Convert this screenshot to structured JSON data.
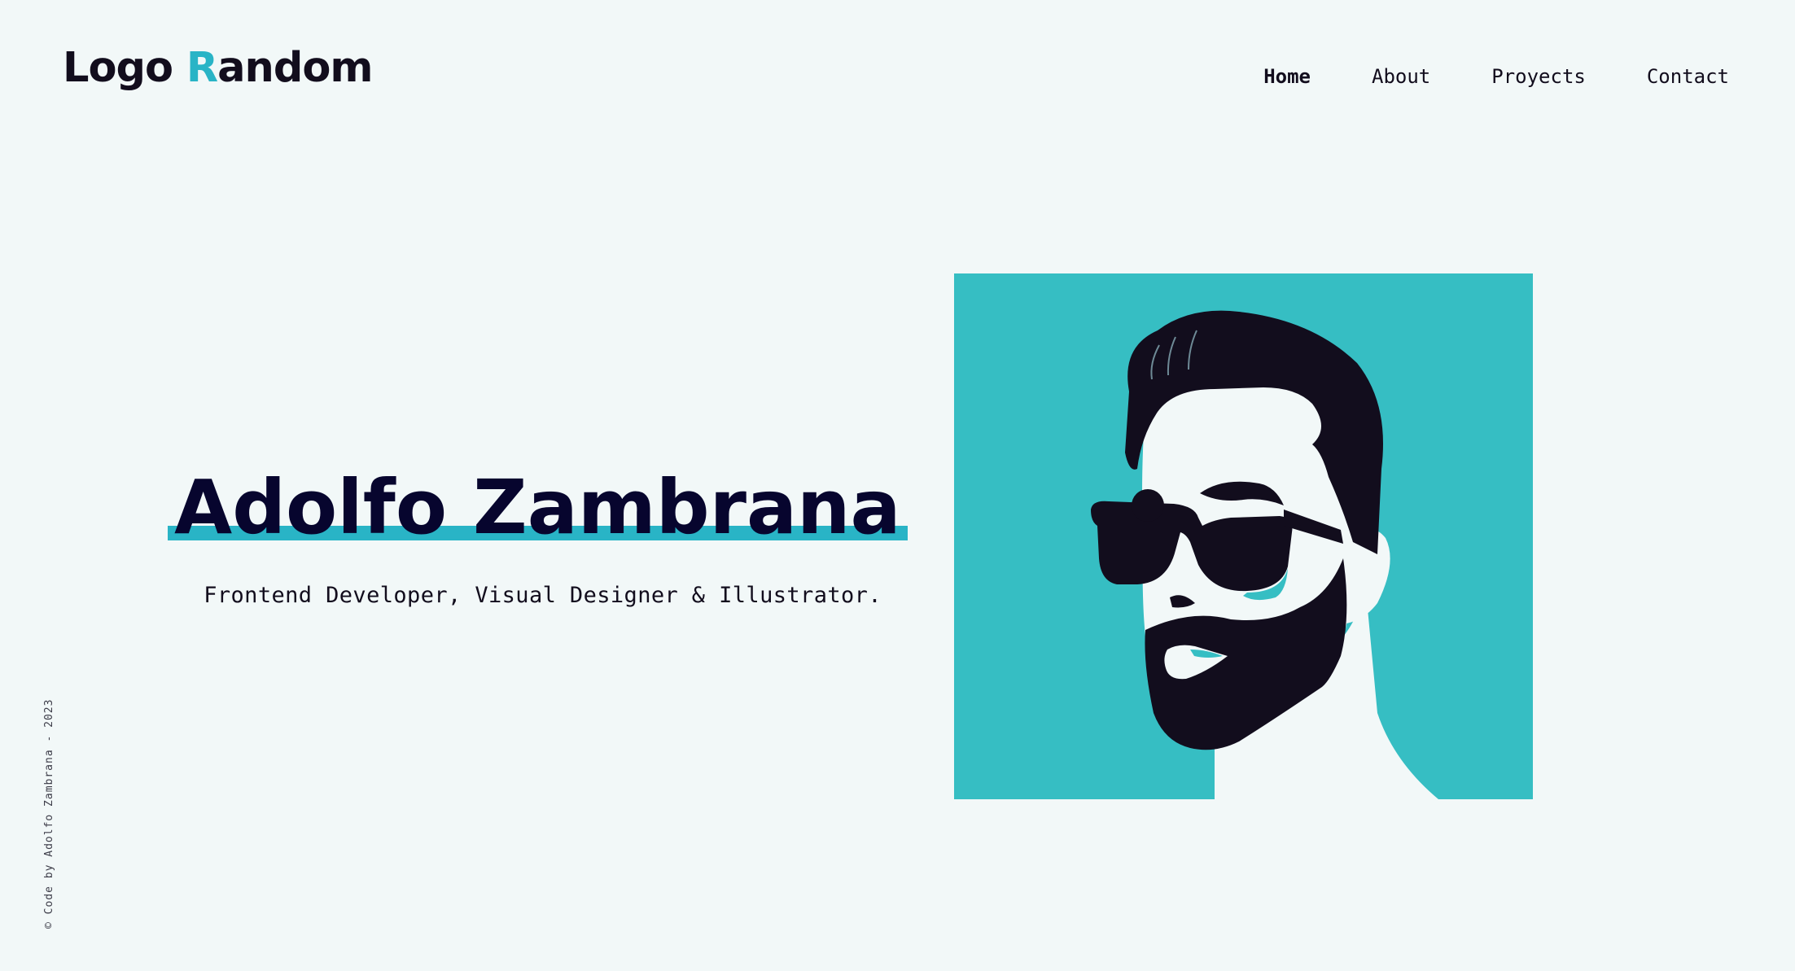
{
  "header": {
    "logo_part1": "Logo ",
    "logo_accent": "R",
    "logo_part2": "andom",
    "accent_color": "#29b4c6"
  },
  "nav": {
    "items": [
      {
        "label": "Home",
        "active": true
      },
      {
        "label": "About",
        "active": false
      },
      {
        "label": "Proyects",
        "active": false
      },
      {
        "label": "Contact",
        "active": false
      }
    ]
  },
  "hero": {
    "name": "Adolfo Zambrana",
    "subtitle": "Frontend Developer, Visual Designer & Illustrator."
  },
  "portrait": {
    "background_color": "#36bec3",
    "hair_color": "#120d1d",
    "skin_color": "#f2f8f8"
  },
  "footer": {
    "copyright": "© Code by Adolfo Zambrana - 2023"
  }
}
